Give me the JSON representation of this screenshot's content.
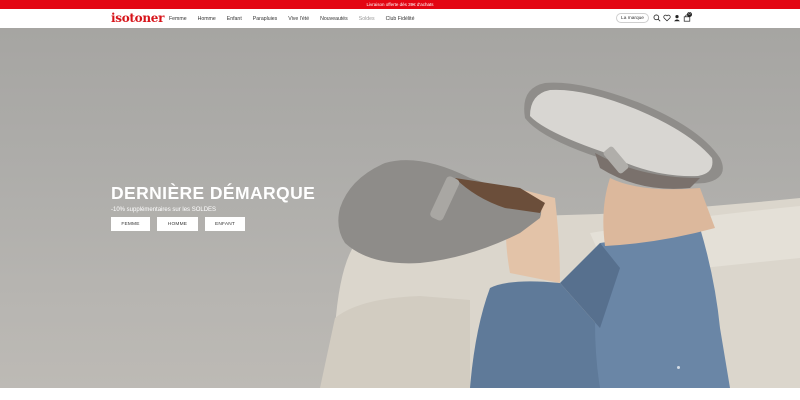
{
  "promo": {
    "text": "Livraison offerte dès 39€ d'achats"
  },
  "header": {
    "logo": "isotoner",
    "nav": [
      "Femme",
      "Homme",
      "Enfant",
      "Parapluies",
      "Vive l'été",
      "Nouveautés",
      "Soldes",
      "Club Fidélité"
    ],
    "brand_button": "La marque",
    "icons": [
      "search-icon",
      "heart-icon",
      "user-icon",
      "bag-icon"
    ],
    "cart_count": "0"
  },
  "hero": {
    "title": "DERNIÈRE DÉMARQUE",
    "subtitle": "-10% supplémentaires sur les SOLDES",
    "buttons": [
      "FEMME",
      "HOMME",
      "ENFANT"
    ]
  },
  "colors": {
    "promo_bg": "#e30613",
    "logo": "#d7141a",
    "hero_text": "#ffffff"
  }
}
